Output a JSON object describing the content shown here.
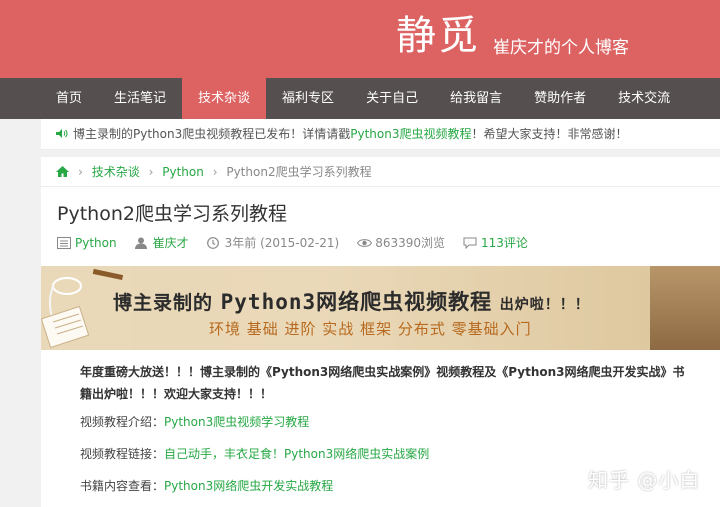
{
  "header": {
    "site_title": "静觅",
    "subtitle": "崔庆才的个人博客",
    "bg_color": "#dd6363"
  },
  "nav": {
    "items": [
      {
        "label": "首页"
      },
      {
        "label": "生活笔记"
      },
      {
        "label": "技术杂谈",
        "active": true
      },
      {
        "label": "福利专区"
      },
      {
        "label": "关于自己"
      },
      {
        "label": "给我留言"
      },
      {
        "label": "赞助作者"
      },
      {
        "label": "技术交流"
      }
    ]
  },
  "notice": {
    "icon": "speaker-icon",
    "text_before": "博主录制的Python3爬虫视频教程已发布！详情请戳",
    "link": "Python3爬虫视频教程",
    "text_after": "！希望大家支持！非常感谢！"
  },
  "breadcrumb": {
    "home_icon": "home-icon",
    "items": [
      "技术杂谈",
      "Python"
    ],
    "current": "Python2爬虫学习系列教程"
  },
  "post": {
    "title": "Python2爬虫学习系列教程",
    "meta": {
      "category": "Python",
      "author": "崔庆才",
      "date": "3年前 (2015-02-21)",
      "views": "863390浏览",
      "comments": "113评论"
    }
  },
  "banner": {
    "line1_prefix": "博主录制的",
    "line1_main": "Python3网络爬虫视频教程",
    "line1_suffix": "出炉啦！！！",
    "line2": "环境 基础 进阶 实战 框架 分布式 零基础入门"
  },
  "content": {
    "announcement": "年度重磅大放送！！！博主录制的《Python3网络爬虫实战案例》视频教程及《Python3网络爬虫开发实战》书籍出炉啦！！！欢迎大家支持！！！",
    "rows": [
      {
        "label": "视频教程介绍：",
        "link": "Python3爬虫视频学习教程"
      },
      {
        "label": "视频教程链接：",
        "link": "自己动手，丰衣足食！Python3网络爬虫实战案例"
      },
      {
        "label": "书籍内容查看：",
        "link": "Python3网络爬虫开发实战教程"
      }
    ]
  },
  "watermark": "知乎 @小白"
}
